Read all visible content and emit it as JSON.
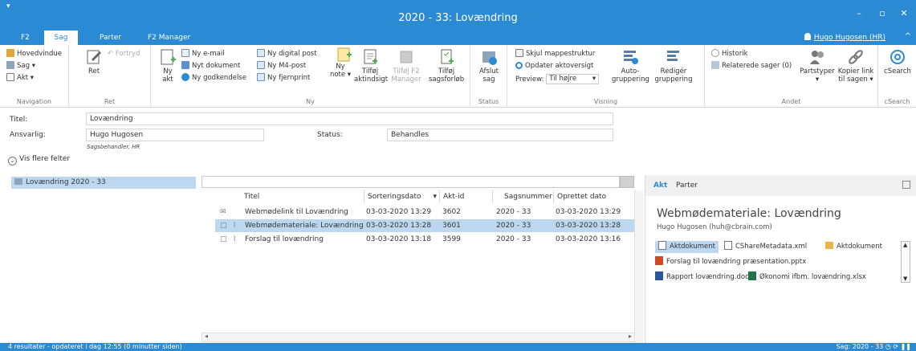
{
  "window": {
    "title": "2020 - 33: Lovændring",
    "app_menu": "▾",
    "minimize": "–",
    "maximize": "▫",
    "close": "✕"
  },
  "tabs": [
    "F2",
    "Sag",
    "Parter",
    "F2 Manager"
  ],
  "active_tab": "Sag",
  "user": {
    "name": "Hugo Hugosen (HR)",
    "collapse": "^"
  },
  "ribbon": {
    "navigation": {
      "label": "Navigation",
      "items": [
        "Hovedvindue",
        "Sag ▾",
        "Akt ▾"
      ]
    },
    "ret": {
      "label": "Ret",
      "ret": "Ret",
      "fortryd": "Fortryd"
    },
    "ny": {
      "label": "Ny",
      "ny_akt": [
        "Ny",
        "akt"
      ],
      "col1": [
        "Ny e-mail",
        "Nyt dokument",
        "Ny godkendelse"
      ],
      "col2": [
        "Ny digital post",
        "Ny M4-post",
        "Ny fjernprint"
      ],
      "ny_note": [
        "Ny",
        "note ▾"
      ],
      "tilfoj_aktindsigt": [
        "Tilføj",
        "aktindsigt"
      ],
      "tilfoj_f2_manager": [
        "Tilføj F2",
        "Manager"
      ],
      "tilfoj_sagsforlob": [
        "Tilføj",
        "sagsforløb"
      ]
    },
    "status": {
      "label": "Status",
      "afslut_sag": [
        "Afslut",
        "sag"
      ]
    },
    "visning": {
      "label": "Visning",
      "skjul": "Skjul mappestruktur",
      "opdater": "Opdater aktoversigt",
      "preview_label": "Preview:",
      "preview_value": "Til højre",
      "auto": [
        "Auto-",
        "gruppering"
      ],
      "rediger": [
        "Redigér",
        "gruppering"
      ]
    },
    "andet": {
      "label": "Andet",
      "historik": "Historik",
      "relaterede": "Relaterede sager (0)",
      "partstyper": [
        "Partstyper",
        "▾"
      ],
      "kopier": [
        "Kopier link",
        "til sagen ▾"
      ]
    },
    "csearch": {
      "label": "cSearch",
      "btn": "cSearch"
    }
  },
  "form": {
    "titel_label": "Titel:",
    "titel_value": "Lovændring",
    "ansvarlig_label": "Ansvarlig:",
    "ansvarlig_value": "Hugo Hugosen",
    "ansvarlig_sub": "Sagsbehandler, HR",
    "status_label": "Status:",
    "status_value": "Behandles",
    "more_fields": "Vis flere felter"
  },
  "tree": {
    "item": "Lovændring 2020 - 33"
  },
  "grid": {
    "columns": [
      "Titel",
      "Sorteringsdato",
      "Akt-id",
      "Sagsnummer",
      "Oprettet dato"
    ],
    "rows": [
      {
        "title": "Webmødelink til Lovændring",
        "sort_date": "03-03-2020 13:29",
        "akt_id": "3602",
        "case_no": "2020 - 33",
        "created": "03-03-2020 13:29",
        "selected": false,
        "attach": false
      },
      {
        "title": "Webmødemateriale: Lovændring",
        "sort_date": "03-03-2020 13:28",
        "akt_id": "3601",
        "case_no": "2020 - 33",
        "created": "03-03-2020 13:28",
        "selected": true,
        "attach": true
      },
      {
        "title": "Forslag til lovændring",
        "sort_date": "03-03-2020 13:18",
        "akt_id": "3599",
        "case_no": "2020 - 33",
        "created": "03-03-2020 13:16",
        "selected": false,
        "attach": true
      }
    ]
  },
  "preview": {
    "tabs": [
      "Akt",
      "Parter"
    ],
    "title": "Webmødemateriale: Lovændring",
    "author": "Hugo Hugosen (huh@cbrain.com)",
    "attachments": [
      "Aktdokument",
      "CShareMetadata.xml",
      "Aktdokument",
      "Forslag til lovændring præsentation.pptx",
      "Rapport lovændring.docx",
      "Økonomi ifbm. lovændring.xlsx"
    ]
  },
  "status_bar": {
    "left": "4 resultater - opdateret i dag 12:55 (0 minutter siden)",
    "right": "Sag: 2020 - 33"
  },
  "colors": {
    "accent": "#2a8ad4",
    "selection": "#bcd8f0"
  }
}
